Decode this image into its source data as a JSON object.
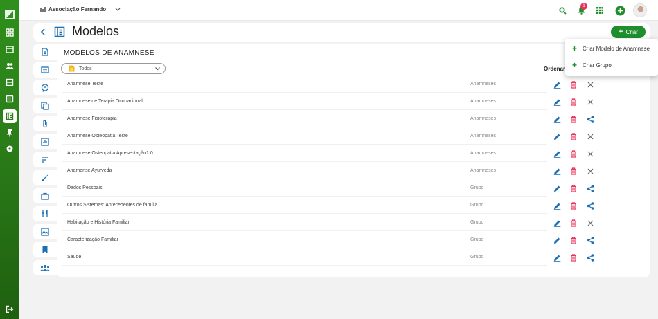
{
  "app": {
    "organization": "Associação Fernando",
    "notification_count": "1"
  },
  "colors": {
    "accent": "#1f8f2e",
    "action_blue": "#1b6fb5",
    "delete_red": "#e8335a"
  },
  "header": {
    "title": "Modelos",
    "create_label": "Criar"
  },
  "section": {
    "title": "MODELOS DE ANAMNESE"
  },
  "filter": {
    "selected": "Todos"
  },
  "order_label": "Ordenar",
  "dropdown": {
    "items": [
      {
        "label": "Criar Modelo de Anamnese"
      },
      {
        "label": "Criar Grupo"
      }
    ]
  },
  "rows": [
    {
      "name": "Anamnese Teste",
      "type": "Anamneses",
      "third_action": "close"
    },
    {
      "name": "Anamnese de Terapia Ocupacional",
      "type": "Anamneses",
      "third_action": "close"
    },
    {
      "name": "Anamnese Fisioterapia",
      "type": "Anamneses",
      "third_action": "share"
    },
    {
      "name": "Anamnese Osteopatia Teste",
      "type": "Anamneses",
      "third_action": "close"
    },
    {
      "name": "Anamnese Osteopatia Apresentação1.0",
      "type": "Anamneses",
      "third_action": "close"
    },
    {
      "name": "Anamense Ayurveda",
      "type": "Anamneses",
      "third_action": "close"
    },
    {
      "name": "Dados Pessoais",
      "type": "Grupo",
      "third_action": "share"
    },
    {
      "name": "Outros Sistemas: Antecedentes de família",
      "type": "Grupo",
      "third_action": "share"
    },
    {
      "name": "Habitação e História Familiar",
      "type": "Grupo",
      "third_action": "close"
    },
    {
      "name": "Caracterização Familiar",
      "type": "Grupo",
      "third_action": "share"
    },
    {
      "name": "Saude",
      "type": "Grupo",
      "third_action": "share"
    }
  ]
}
